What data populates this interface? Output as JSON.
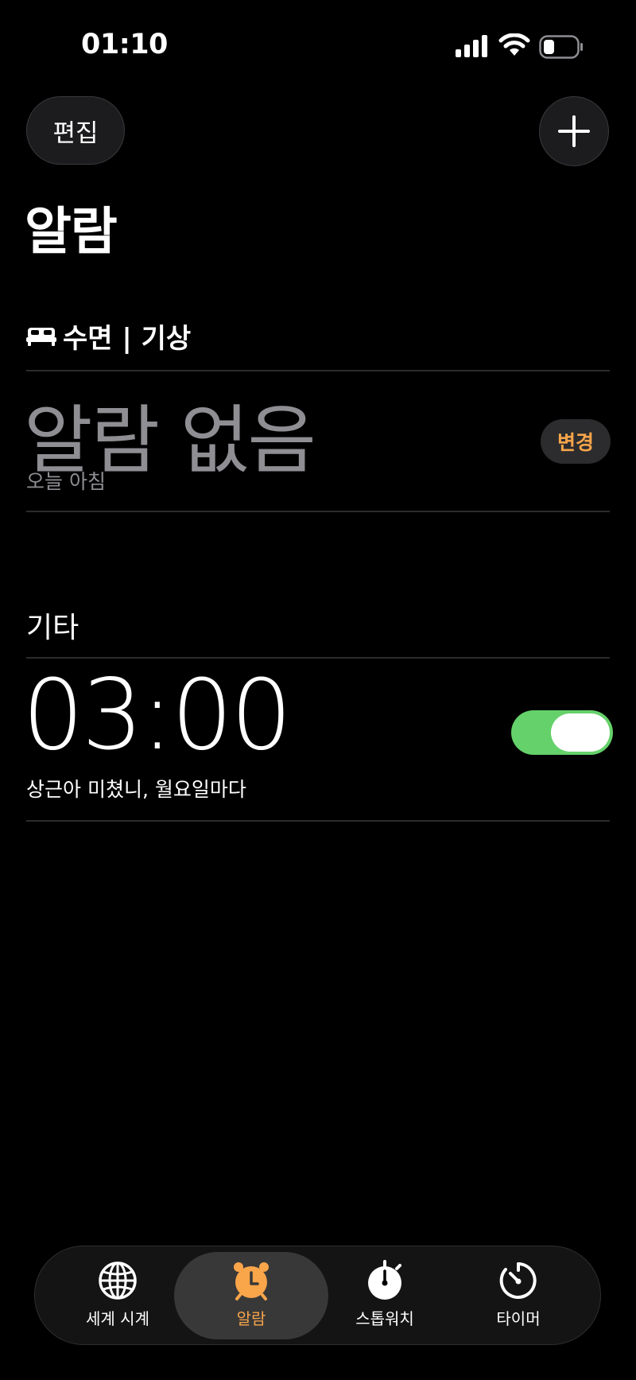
{
  "status_bar": {
    "time": "01:10"
  },
  "header": {
    "edit_label": "편집",
    "add_icon": "plus-icon",
    "title": "알람"
  },
  "sleep_section": {
    "icon": "bed-icon",
    "title": "수면 | 기상",
    "alarm_text": "알람 없음",
    "subtitle": "오늘 아침",
    "change_label": "변경"
  },
  "other_section": {
    "title": "기타",
    "alarms": [
      {
        "time": "03:00",
        "label": "상근아 미쳤니, 월요일마다",
        "enabled": true
      }
    ]
  },
  "tab_bar": {
    "tabs": [
      {
        "label": "세계 시계",
        "icon": "globe-icon",
        "active": false
      },
      {
        "label": "알람",
        "icon": "alarm-clock-icon",
        "active": true
      },
      {
        "label": "스톱워치",
        "icon": "stopwatch-icon",
        "active": false
      },
      {
        "label": "타이머",
        "icon": "timer-icon",
        "active": false
      }
    ]
  },
  "colors": {
    "background": "#000000",
    "accent": "#f9a54a",
    "toggle_on": "#65d16a",
    "secondary_text": "#8e8e93"
  }
}
